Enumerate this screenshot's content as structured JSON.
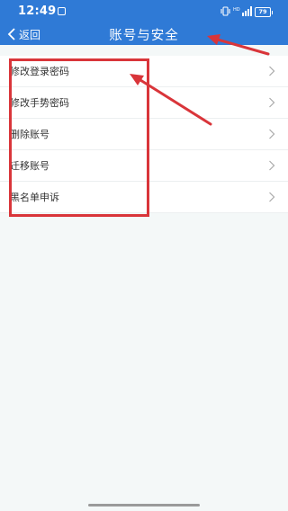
{
  "status_bar": {
    "time": "12:49",
    "battery": "79",
    "icons": [
      "square-notification-icon",
      "vibrate-icon",
      "signal-icon",
      "battery-icon"
    ]
  },
  "header": {
    "back_label": "返回",
    "title": "账号与安全",
    "background_color": "#2f7ad6"
  },
  "menu": {
    "items": [
      {
        "label": "修改登录密码"
      },
      {
        "label": "修改手势密码"
      },
      {
        "label": "删除账号"
      },
      {
        "label": "迁移账号"
      },
      {
        "label": "黑名单申诉"
      }
    ]
  },
  "annotation": {
    "color": "#d9353a"
  }
}
